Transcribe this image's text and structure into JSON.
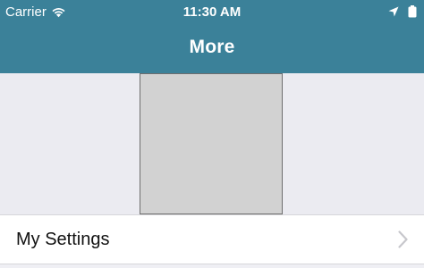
{
  "status_bar": {
    "carrier": "Carrier",
    "time": "11:30 AM",
    "wifi_icon": "wifi-icon",
    "location_icon": "location-arrow-icon",
    "battery_icon": "battery-icon"
  },
  "nav": {
    "title": "More"
  },
  "profile": {
    "image": "placeholder-image"
  },
  "list": {
    "items": [
      {
        "label": "My Settings",
        "icon": "chevron-right-icon"
      }
    ]
  },
  "colors": {
    "header_bg": "#3b8199",
    "page_bg": "#ebebf1",
    "placeholder_bg": "#d2d2d2",
    "chevron": "#c7c7cc"
  }
}
